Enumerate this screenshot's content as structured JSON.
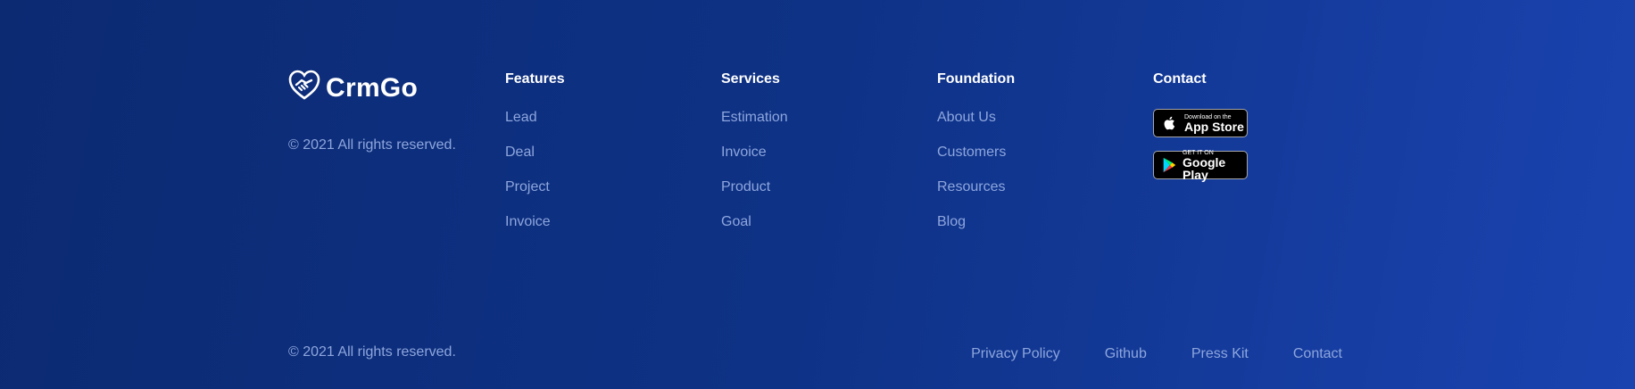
{
  "brand": {
    "name": "CrmGo",
    "logo_icon": "handshake-heart-icon"
  },
  "copyright_top": "© 2021 All rights reserved.",
  "copyright_bottom": "© 2021 All rights reserved.",
  "columns": [
    {
      "title": "Features",
      "links": [
        "Lead",
        "Deal",
        "Project",
        "Invoice"
      ]
    },
    {
      "title": "Services",
      "links": [
        "Estimation",
        "Invoice",
        "Product",
        "Goal"
      ]
    },
    {
      "title": "Foundation",
      "links": [
        "About Us",
        "Customers",
        "Resources",
        "Blog"
      ]
    }
  ],
  "contact": {
    "title": "Contact",
    "app_store": {
      "small": "Download on the",
      "big": "App Store",
      "icon": "apple-icon"
    },
    "google_play": {
      "small": "GET IT ON",
      "big": "Google Play",
      "icon": "google-play-icon"
    }
  },
  "bottom_links": [
    "Privacy Policy",
    "Github",
    "Press Kit",
    "Contact"
  ],
  "colors": {
    "background_start": "#0c2a72",
    "background_end": "#1a43b0",
    "link": "#8ea6dd",
    "heading": "#ffffff"
  }
}
